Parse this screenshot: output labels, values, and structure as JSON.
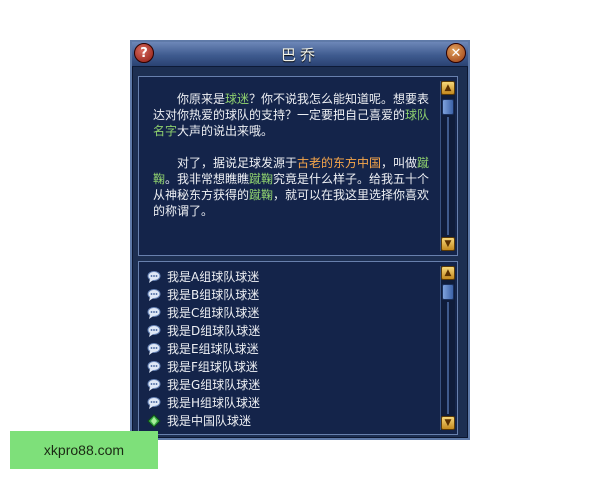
{
  "dialog": {
    "title": "巴乔",
    "help_glyph": "?",
    "close_glyph": "✕"
  },
  "npc_text": {
    "p1": [
      {
        "t": "你原来是",
        "hl": false
      },
      {
        "t": "球迷",
        "hl": true
      },
      {
        "t": "？你不说我怎么能知道呢。想要表达对你热爱的球队的支持？一定要把自己喜爱的",
        "hl": false
      },
      {
        "t": "球队名字",
        "hl": true
      },
      {
        "t": "大声的说出来哦。",
        "hl": false
      }
    ],
    "p2": [
      {
        "t": "对了，据说足球发源于",
        "hl": false
      },
      {
        "t": "古老的东方中国",
        "hl": "orange"
      },
      {
        "t": "，叫做",
        "hl": false
      },
      {
        "t": "蹴鞠",
        "hl": true
      },
      {
        "t": "。我非常想瞧瞧",
        "hl": false
      },
      {
        "t": "蹴鞠",
        "hl": true
      },
      {
        "t": "究竟是什么样子。给我五十个从神秘东方获得的",
        "hl": false
      },
      {
        "t": "蹴鞠",
        "hl": true
      },
      {
        "t": "，就可以在我这里选择你喜欢的称谓了。",
        "hl": false
      }
    ]
  },
  "options": [
    {
      "label": "我是A组球队球迷",
      "icon": "speech-bubble-icon"
    },
    {
      "label": "我是B组球队球迷",
      "icon": "speech-bubble-icon"
    },
    {
      "label": "我是C组球队球迷",
      "icon": "speech-bubble-icon"
    },
    {
      "label": "我是D组球队球迷",
      "icon": "speech-bubble-icon"
    },
    {
      "label": "我是E组球队球迷",
      "icon": "speech-bubble-icon"
    },
    {
      "label": "我是F组球队球迷",
      "icon": "speech-bubble-icon"
    },
    {
      "label": "我是G组球队球迷",
      "icon": "speech-bubble-icon"
    },
    {
      "label": "我是H组球队球迷",
      "icon": "speech-bubble-icon"
    },
    {
      "label": "我是中国队球迷",
      "icon": "green-gem-icon"
    }
  ],
  "watermark": "xkpro88.com",
  "colors": {
    "highlight_green": "#8ed06e",
    "highlight_orange": "#f7a64a",
    "panel_bg": "#14244a",
    "frame_bg": "#1d2f52"
  }
}
